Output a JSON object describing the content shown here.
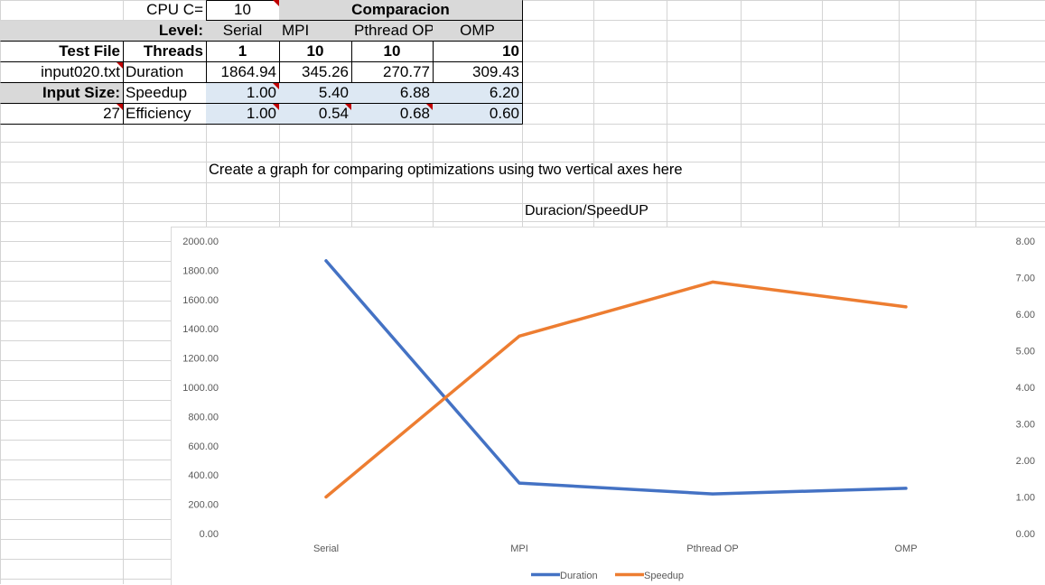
{
  "sheet": {
    "row1": {
      "cpu_label": "CPU C=",
      "cpu_value": "10",
      "comparacion": "Comparacion"
    },
    "row2": {
      "level_label": "Level:",
      "serial": "Serial",
      "mpi": "MPI",
      "pthread": "Pthread OP",
      "omp": "OMP"
    },
    "row3": {
      "test_file_label": "Test File",
      "threads_label": "Threads",
      "serial": "1",
      "mpi": "10",
      "pthread": "10",
      "omp": "10"
    },
    "row4": {
      "file_name": "input020.txt",
      "metric": "Duration",
      "serial": "1864.94",
      "mpi": "345.26",
      "pthread": "270.77",
      "omp": "309.43"
    },
    "row5": {
      "input_size_label": "Input Size:",
      "metric": "Speedup",
      "serial": "1.00",
      "mpi": "5.40",
      "pthread": "6.88",
      "omp": "6.20"
    },
    "row6": {
      "input_size_value": "27",
      "metric": "Efficiency",
      "serial": "1.00",
      "mpi": "0.54",
      "pthread": "0.68",
      "omp": "0.60"
    },
    "note": "Create a graph for comparing optimizations using two vertical axes here"
  },
  "chart_data": {
    "type": "line",
    "title": "Duracion/SpeedUP",
    "categories": [
      "Serial",
      "MPI",
      "Pthread OP",
      "OMP"
    ],
    "series": [
      {
        "name": "Duration",
        "axis": "left",
        "color": "#4472c4",
        "values": [
          1864.94,
          345.26,
          270.77,
          309.43
        ]
      },
      {
        "name": "Speedup",
        "axis": "right",
        "color": "#ed7d31",
        "values": [
          1.0,
          5.4,
          6.88,
          6.2
        ]
      }
    ],
    "y_left": {
      "min": 0,
      "max": 2000,
      "ticks": [
        "0.00",
        "200.00",
        "400.00",
        "600.00",
        "800.00",
        "1000.00",
        "1200.00",
        "1400.00",
        "1600.00",
        "1800.00",
        "2000.00"
      ]
    },
    "y_right": {
      "min": 0,
      "max": 8,
      "ticks": [
        "0.00",
        "1.00",
        "2.00",
        "3.00",
        "4.00",
        "5.00",
        "6.00",
        "7.00",
        "8.00"
      ]
    },
    "legend_position": "bottom",
    "grid": false
  }
}
